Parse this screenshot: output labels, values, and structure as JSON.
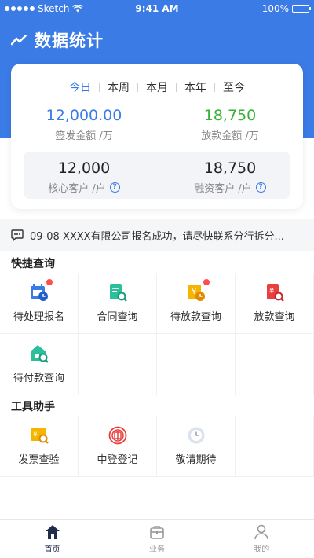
{
  "status_bar": {
    "carrier": "Sketch",
    "time": "9:41 AM",
    "battery": "100%"
  },
  "header": {
    "title": "数据统计"
  },
  "period_tabs": [
    {
      "label": "今日",
      "active": true
    },
    {
      "label": "本周",
      "active": false
    },
    {
      "label": "本月",
      "active": false
    },
    {
      "label": "本年",
      "active": false
    },
    {
      "label": "至今",
      "active": false
    }
  ],
  "stats": {
    "issued_amount": {
      "value": "12,000.00",
      "label": "签发金额 /万",
      "color": "#3b7be6"
    },
    "loan_amount": {
      "value": "18,750",
      "label": "放款金额 /万",
      "color": "#34b233"
    },
    "core_customers": {
      "value": "12,000",
      "label": "核心客户 /户"
    },
    "financing_customers": {
      "value": "18,750",
      "label": "融资客户 /户"
    }
  },
  "notice": {
    "text": "09-08 XXXX有限公司报名成功，请尽快联系分行拆分..."
  },
  "quick_query": {
    "title": "快捷查询",
    "items": [
      {
        "label": "待处理报名",
        "icon": "calendar-clock-icon"
      },
      {
        "label": "合同查询",
        "icon": "document-search-icon"
      },
      {
        "label": "待放款查询",
        "icon": "pending-loan-icon"
      },
      {
        "label": "放款查询",
        "icon": "loan-search-icon"
      },
      {
        "label": "待付款查询",
        "icon": "payment-search-icon"
      }
    ]
  },
  "tools": {
    "title": "工具助手",
    "items": [
      {
        "label": "发票查验",
        "icon": "invoice-check-icon"
      },
      {
        "label": "中登登记",
        "icon": "registration-seal-icon"
      },
      {
        "label": "敬请期待",
        "icon": "coming-soon-clock-icon"
      }
    ]
  },
  "tab_bar": [
    {
      "label": "首页",
      "icon": "home-icon",
      "active": true
    },
    {
      "label": "业务",
      "icon": "briefcase-icon",
      "active": false
    },
    {
      "label": "我的",
      "icon": "user-icon",
      "active": false
    }
  ],
  "colors": {
    "primary": "#3b7be6",
    "green": "#34b233",
    "badge": "#ff4d4f"
  }
}
